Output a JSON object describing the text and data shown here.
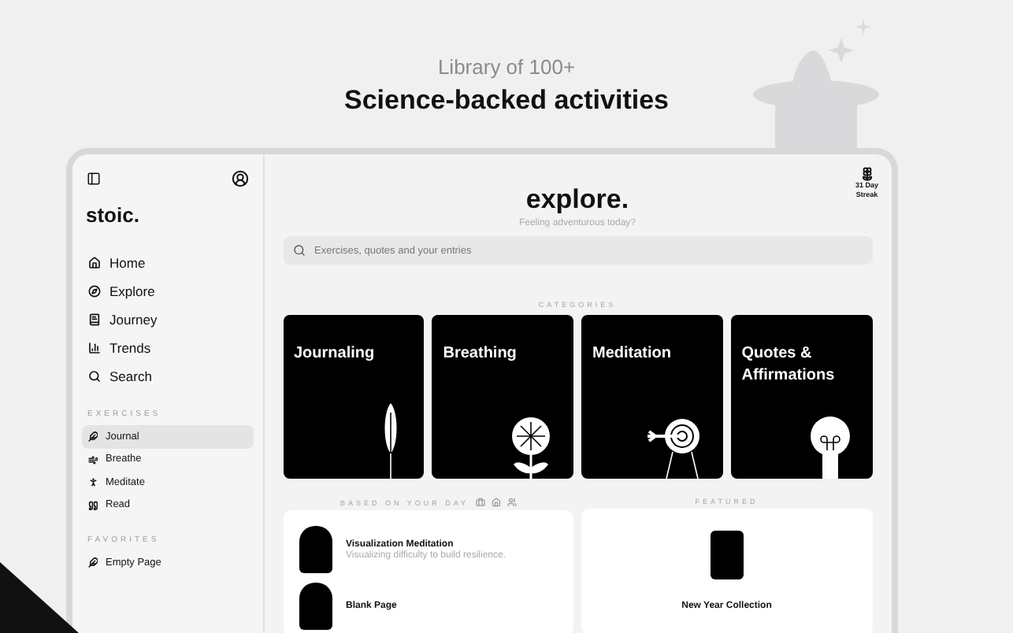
{
  "header": {
    "kicker": "Library of 100+",
    "title": "Science-backed activities"
  },
  "sidebar": {
    "brand": "stoic.",
    "nav": [
      {
        "label": "Home"
      },
      {
        "label": "Explore"
      },
      {
        "label": "Journey"
      },
      {
        "label": "Trends"
      },
      {
        "label": "Search"
      }
    ],
    "sections": [
      {
        "title": "EXERCISES",
        "items": [
          {
            "label": "Journal",
            "selected": true
          },
          {
            "label": "Breathe",
            "selected": false
          },
          {
            "label": "Meditate",
            "selected": false
          },
          {
            "label": "Read",
            "selected": false
          }
        ]
      },
      {
        "title": "FAVORITES",
        "items": [
          {
            "label": "Empty Page",
            "selected": false
          }
        ]
      }
    ]
  },
  "main": {
    "streak": {
      "line_1": "31 Day",
      "line_2": "Streak"
    },
    "title": "explore.",
    "subtitle": "Feeling adventurous today?",
    "search": {
      "placeholder": "Exercises, quotes and your entries"
    },
    "categories_title": "CATEGORIES",
    "categories": [
      {
        "label": "Journaling"
      },
      {
        "label": "Breathing"
      },
      {
        "label": "Meditation"
      },
      {
        "label": "Quotes & Affirmations"
      }
    ],
    "based_on_day": {
      "title": "BASED ON YOUR DAY",
      "items": [
        {
          "title": "Visualization Meditation",
          "subtitle": "Visualizing difficulty to build resilience."
        },
        {
          "title": "Blank Page"
        }
      ]
    },
    "featured": {
      "title": "FEATURED",
      "item": "New Year Collection"
    }
  }
}
